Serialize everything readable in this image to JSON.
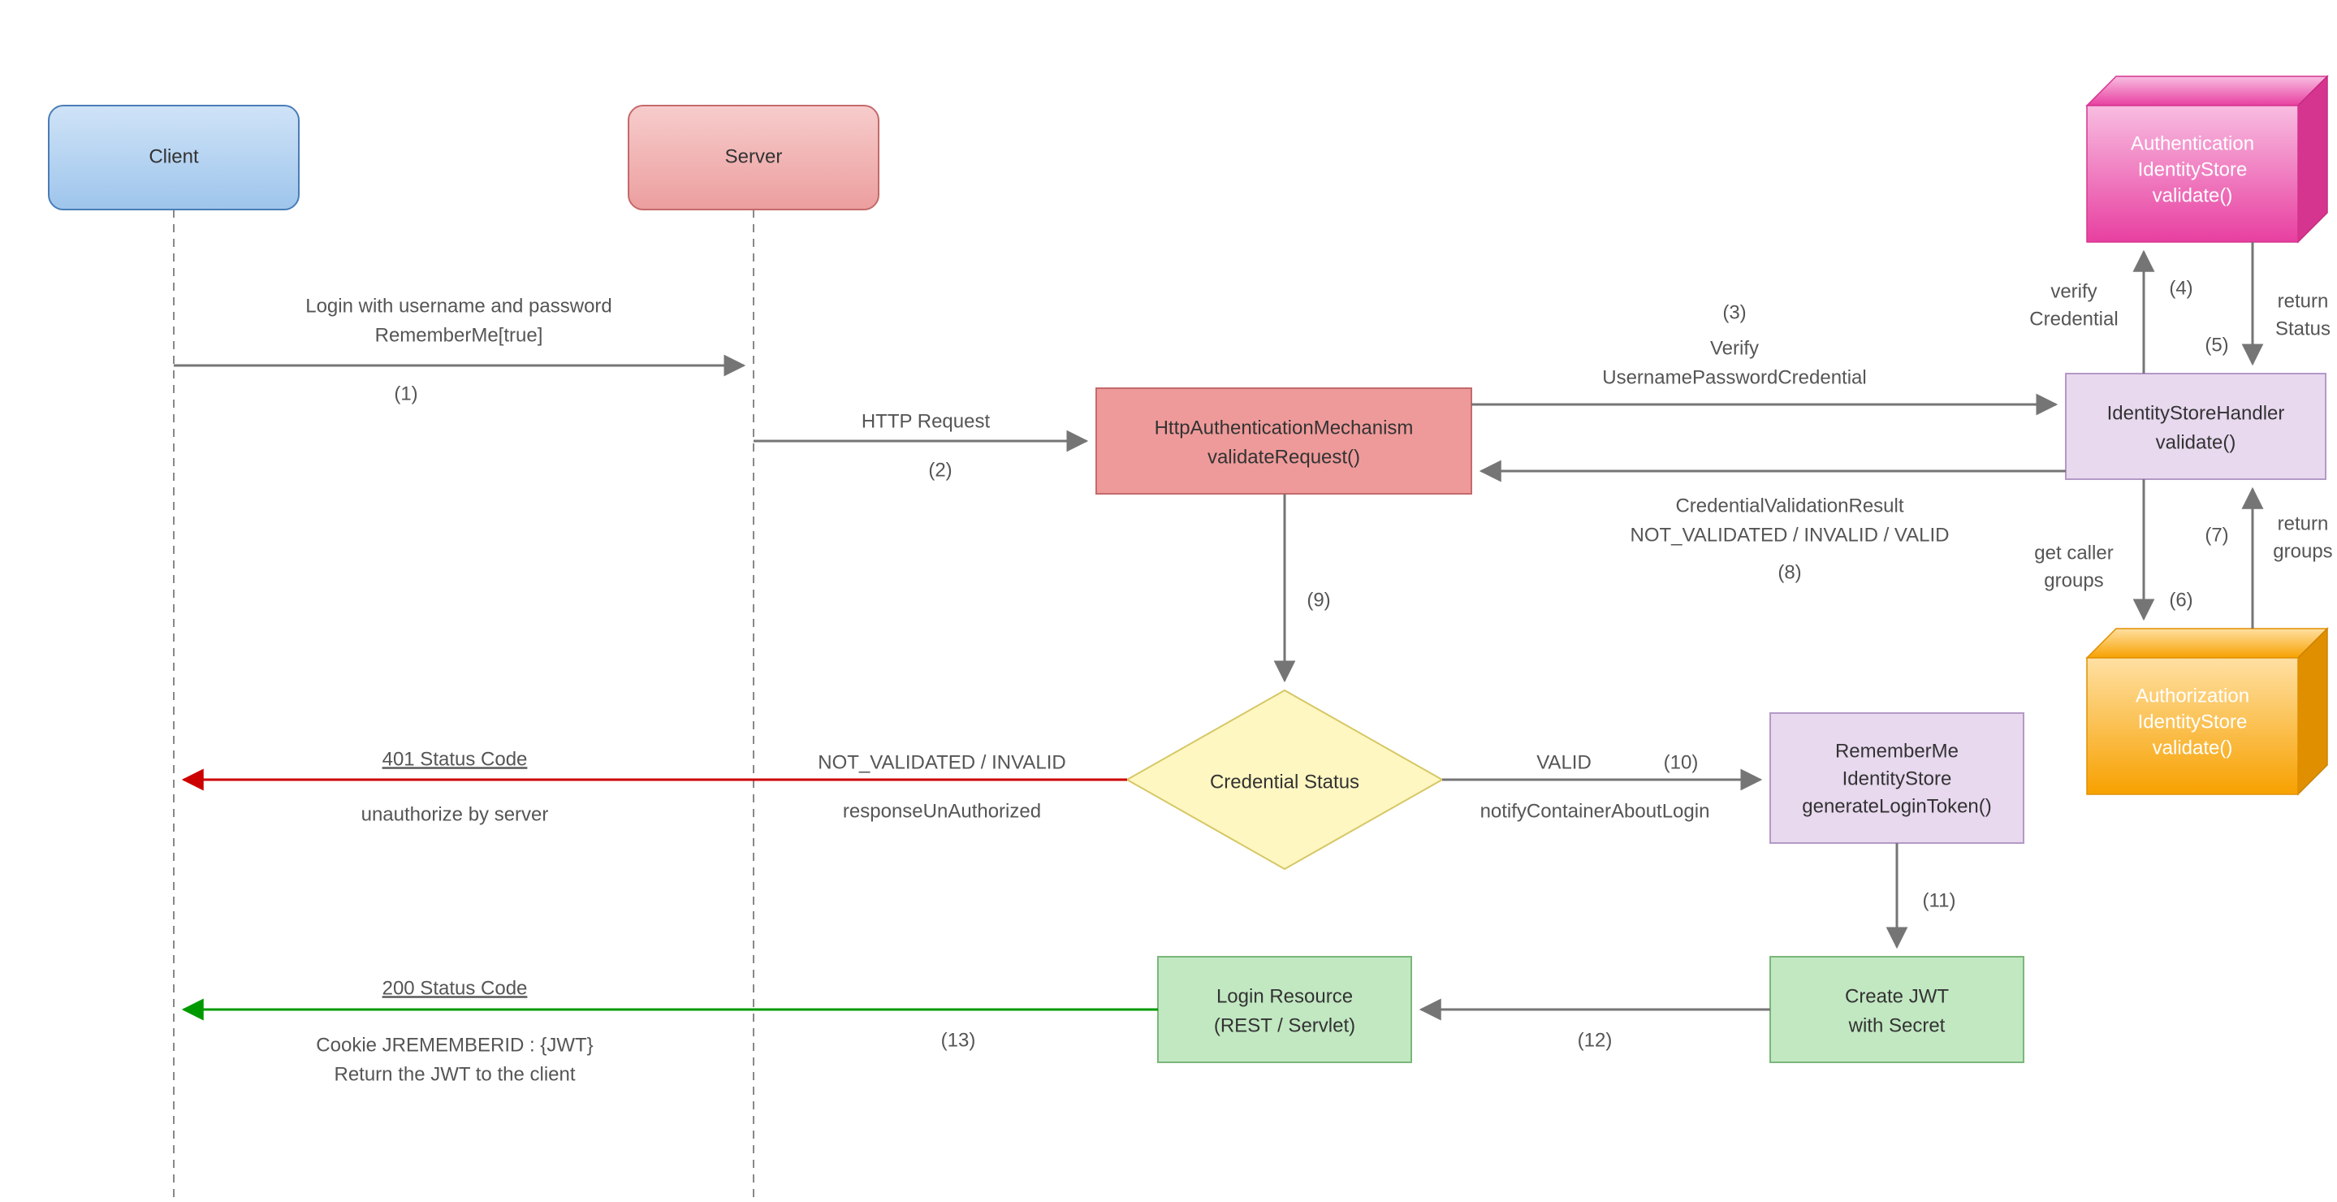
{
  "nodes": {
    "client": {
      "line1": "Client"
    },
    "server": {
      "line1": "Server"
    },
    "httpAuth": {
      "line1": "HttpAuthenticationMechanism",
      "line2": "validateRequest()"
    },
    "idStoreHandler": {
      "line1": "IdentityStoreHandler",
      "line2": "validate()"
    },
    "authStore": {
      "line1": "Authentication",
      "line2": "IdentityStore",
      "line3": "validate()"
    },
    "authzStore": {
      "line1": "Authorization",
      "line2": "IdentityStore",
      "line3": "validate()"
    },
    "credStatus": {
      "line1": "Credential Status"
    },
    "rememberMe": {
      "line1": "RememberMe",
      "line2": "IdentityStore",
      "line3": "generateLoginToken()"
    },
    "createJwt": {
      "line1": "Create JWT",
      "line2": "with Secret"
    },
    "loginResource": {
      "line1": "Login Resource",
      "line2": "(REST / Servlet)"
    }
  },
  "edges": {
    "e1": {
      "a": "Login with username and password",
      "b": "RememberMe[true]",
      "step": "(1)"
    },
    "e2": {
      "a": "HTTP Request",
      "step": "(2)"
    },
    "e3": {
      "a": "Verify",
      "b": "UsernamePasswordCredential",
      "step": "(3)"
    },
    "e4": {
      "a": "verify",
      "b": "Credential",
      "step": "(4)"
    },
    "e5": {
      "a": "return",
      "b": "Status",
      "step": "(5)"
    },
    "e6": {
      "a": "get caller",
      "b": "groups",
      "step": "(6)"
    },
    "e7": {
      "a": "return",
      "b": "groups",
      "step": "(7)"
    },
    "e8": {
      "a": "CredentialValidationResult",
      "b": "NOT_VALIDATED / INVALID / VALID",
      "step": "(8)"
    },
    "e9": {
      "step": "(9)"
    },
    "e10": {
      "a": "VALID",
      "b": "notifyContainerAboutLogin",
      "step": "(10)"
    },
    "e11": {
      "step": "(11)"
    },
    "e12": {
      "step": "(12)"
    },
    "e13": {
      "step": "(13)"
    },
    "invalid": {
      "a": "NOT_VALIDATED / INVALID",
      "b": "responseUnAuthorized"
    },
    "r401": {
      "a": "401 Status Code",
      "b": "unauthorize by server"
    },
    "r200": {
      "a": "200 Status Code",
      "b": "Cookie JREMEMBERID : {JWT}",
      "c": "Return the JWT to the client"
    }
  }
}
